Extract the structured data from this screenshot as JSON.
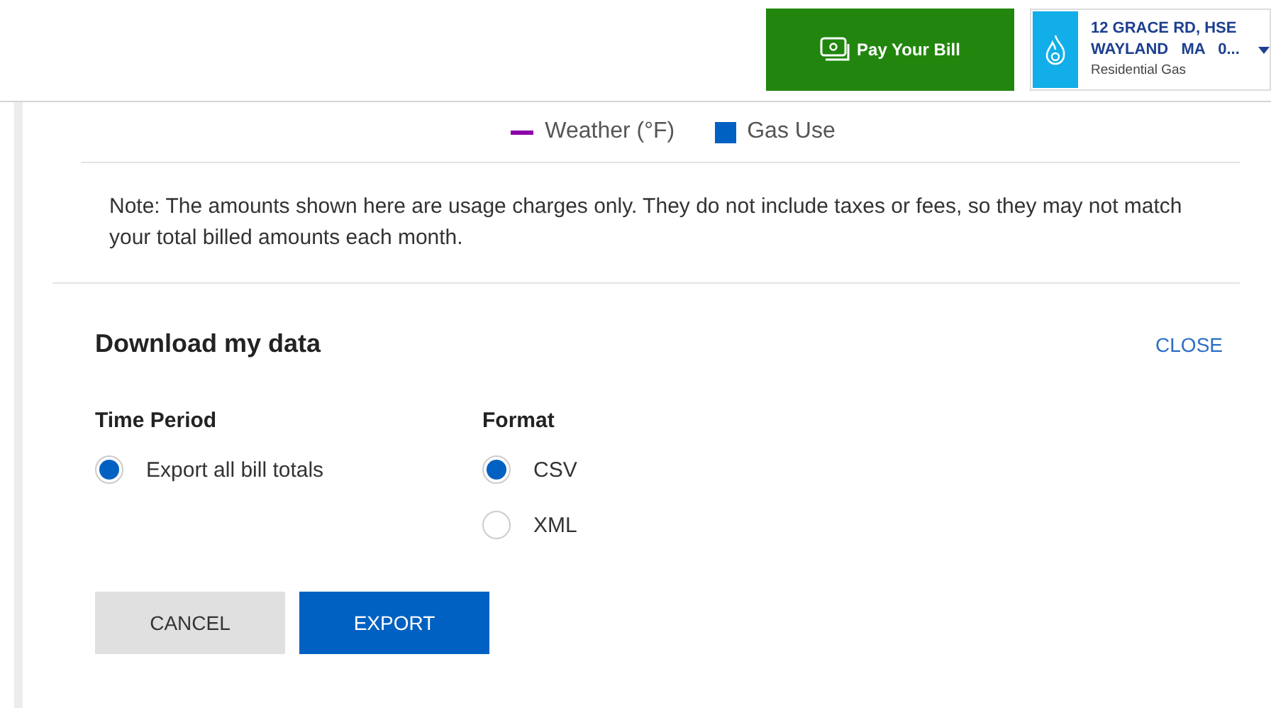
{
  "header": {
    "pay_button": "Pay Your Bill",
    "account": {
      "address_line_1": "12 GRACE RD, HSE",
      "address_line_2": "WAYLAND   MA   0...",
      "service": "Residential Gas"
    }
  },
  "legend": [
    {
      "label": "Weather (°F)",
      "kind": "line",
      "color": "#8b00a8"
    },
    {
      "label": "Gas Use",
      "kind": "square",
      "color": "#0061c2"
    }
  ],
  "note": "Note: The amounts shown here are usage charges only. They do not include taxes or fees, so they may not match your total billed amounts each month.",
  "download": {
    "title": "Download my data",
    "close": "CLOSE",
    "groups": [
      {
        "heading": "Time Period",
        "options": [
          {
            "label": "Export all bill totals",
            "selected": true
          }
        ]
      },
      {
        "heading": "Format",
        "options": [
          {
            "label": "CSV",
            "selected": true
          },
          {
            "label": "XML",
            "selected": false
          }
        ]
      }
    ],
    "buttons": [
      {
        "label": "CANCEL",
        "kind": "secondary"
      },
      {
        "label": "EXPORT",
        "kind": "primary"
      }
    ]
  }
}
